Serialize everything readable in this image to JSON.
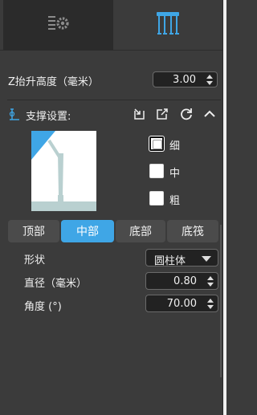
{
  "tabs": [
    {
      "icon": "settings-list-icon"
    },
    {
      "icon": "support-structure-icon"
    }
  ],
  "lift": {
    "label": "Z抬升高度（毫米）",
    "value": "3.00"
  },
  "support": {
    "title": "支撑设置:",
    "header_icons": [
      "import-icon",
      "export-icon",
      "refresh-icon",
      "collapse-icon"
    ]
  },
  "thickness": {
    "options": [
      "细",
      "中",
      "粗"
    ],
    "selected": "细"
  },
  "segments": {
    "items": [
      "顶部",
      "中部",
      "底部",
      "底筏"
    ],
    "active": "中部"
  },
  "params": {
    "shape_label": "形状",
    "shape_value": "圆柱体",
    "diameter_label": "直径（毫米）",
    "diameter_value": "0.80",
    "angle_label": "角度 (°)",
    "angle_value": "70.00"
  },
  "colors": {
    "accent": "#3fa6e6",
    "preview_support": "#b9d0d0",
    "preview_bg": "#ffffff"
  }
}
